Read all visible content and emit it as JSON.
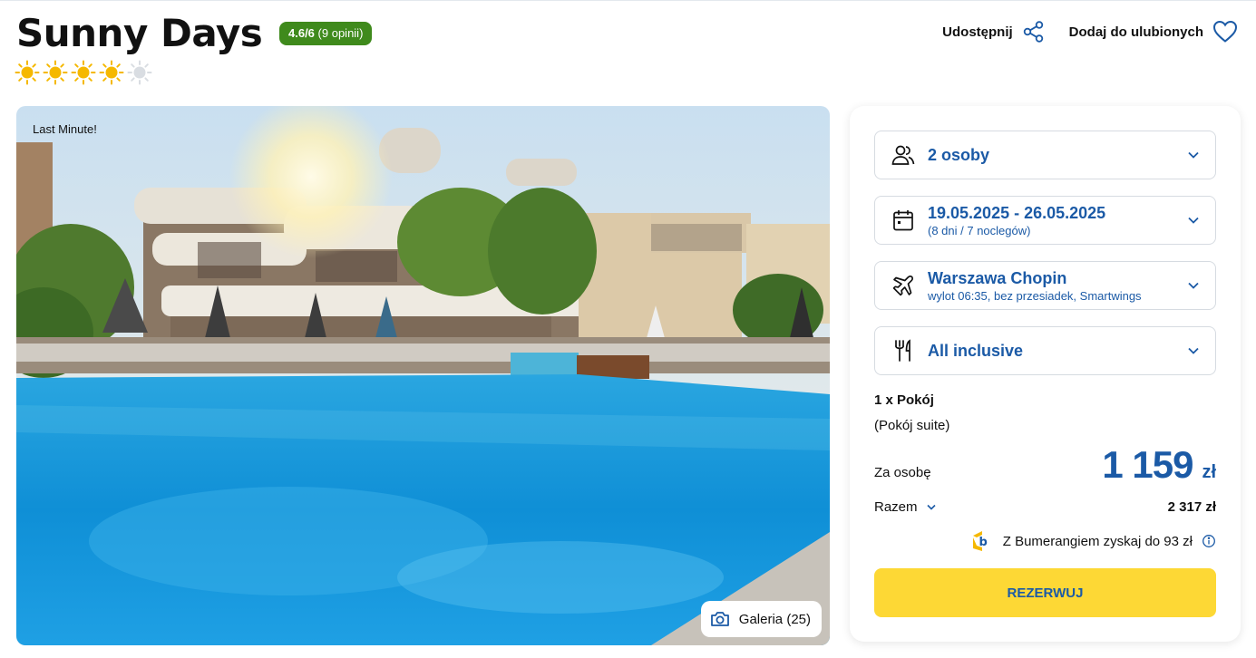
{
  "hotel": {
    "name": "Sunny Days",
    "rating_score": "4.6/6",
    "rating_count": "(9 opinii)",
    "stars": 4,
    "stars_max": 5
  },
  "actions": {
    "share_label": "Udostępnij",
    "favorite_label": "Dodaj do ulubionych"
  },
  "photo": {
    "badge": "Last Minute!",
    "gallery_label": "Galeria (25)"
  },
  "booking": {
    "persons": "2 osoby",
    "dates": "19.05.2025 - 26.05.2025",
    "dates_sub": "(8 dni / 7 noclegów)",
    "airport": "Warszawa Chopin",
    "flight_info": "wylot 06:35, bez przesiadek, Smartwings",
    "board": "All inclusive",
    "room": "1 x Pokój",
    "room_type": "(Pokój suite)",
    "per_person_label": "Za osobę",
    "price": "1 159",
    "currency": "zł",
    "total_label": "Razem",
    "total": "2 317 zł",
    "bumerang_text": "Z Bumerangiem zyskaj do 93 zł",
    "reserve_label": "REZERWUJ"
  },
  "colors": {
    "accent": "#1b5aa6",
    "rating_bg": "#3f8a1c",
    "star": "#f5b800",
    "button": "#fdd835"
  }
}
